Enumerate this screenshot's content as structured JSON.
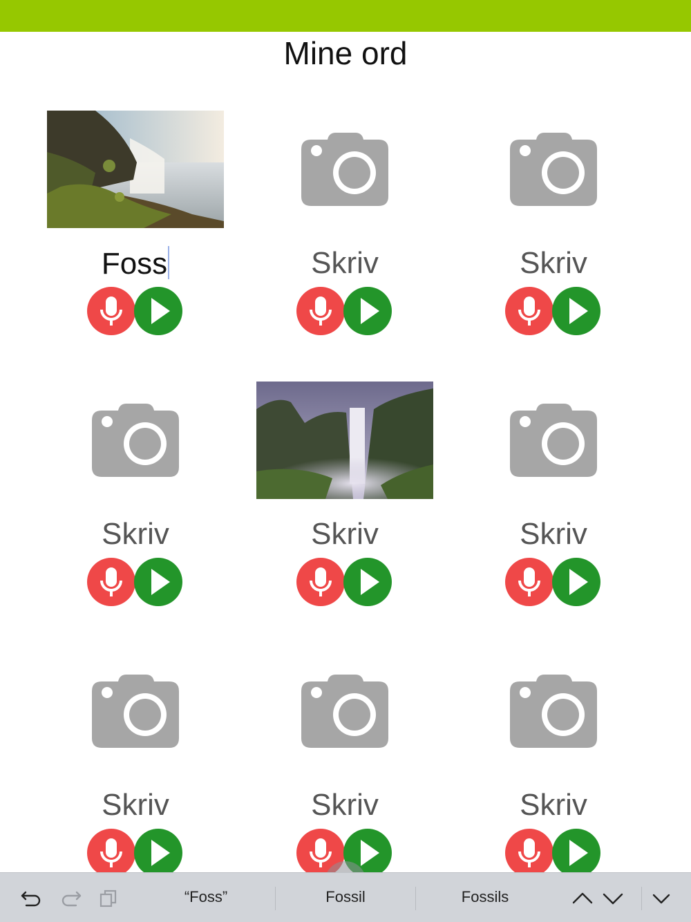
{
  "header": {
    "title": "Mine ord",
    "bar_color": "#96c800"
  },
  "words": [
    {
      "text": "Foss",
      "media": "photo-waterfall-sunny",
      "filled": true,
      "focused": true
    },
    {
      "text": "Skriv",
      "media": "camera-icon",
      "filled": false
    },
    {
      "text": "Skriv",
      "media": "camera-icon",
      "filled": false
    },
    {
      "text": "Skriv",
      "media": "camera-icon",
      "filled": false
    },
    {
      "text": "Skriv",
      "media": "photo-waterfall-misty",
      "filled": false
    },
    {
      "text": "Skriv",
      "media": "camera-icon",
      "filled": false
    },
    {
      "text": "Skriv",
      "media": "camera-icon",
      "filled": false
    },
    {
      "text": "Skriv",
      "media": "camera-icon",
      "filled": false
    },
    {
      "text": "Skriv",
      "media": "camera-icon",
      "filled": false
    }
  ],
  "colors": {
    "record": "#ef4848",
    "play": "#23952a",
    "camera": "#a6a6a6"
  },
  "keyboard_bar": {
    "suggestions": [
      "“Foss”",
      "Fossil",
      "Fossils"
    ],
    "icons": [
      "undo-icon",
      "redo-icon",
      "paste-icon",
      "chevron-up-icon",
      "chevron-down-icon",
      "dismiss-keyboard-icon"
    ]
  }
}
